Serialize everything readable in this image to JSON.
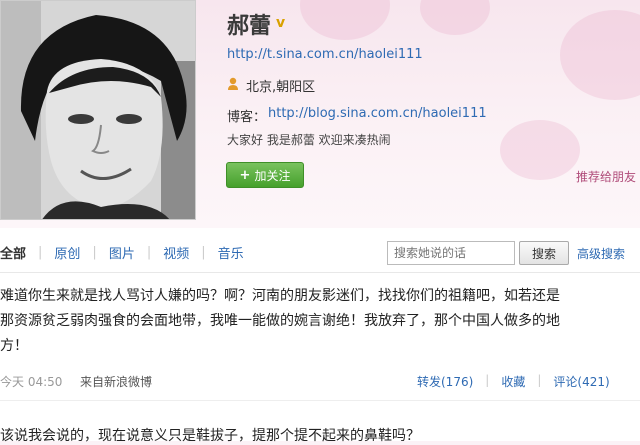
{
  "profile": {
    "name": "郝蕾",
    "verified_badge": "v",
    "weibo_url": "http://t.sina.com.cn/haolei111",
    "location": "北京,朝阳区",
    "blog_label": "博客：",
    "blog_url": "http://blog.sina.com.cn/haolei111",
    "intro": "大家好  我是郝蕾  欢迎来凑热闹",
    "follow_label": "加关注",
    "follow_plus": "+",
    "recommend_label": "推荐给朋友"
  },
  "nav": {
    "tabs": [
      {
        "label": "全部"
      },
      {
        "label": "原创"
      },
      {
        "label": "图片"
      },
      {
        "label": "视频"
      },
      {
        "label": "音乐"
      }
    ],
    "search_placeholder": "搜索她说的话",
    "search_button": "搜索",
    "advanced_search": "高级搜索"
  },
  "post": {
    "lines": [
      "难道你生来就是找人骂讨人嫌的吗？啊？河南的朋友影迷们，找找你们的祖籍吧，如若还是",
      "那资源贫乏弱肉强食的会面地带，我唯一能做的婉言谢绝！我放弃了，那个中国人做多的地",
      "方！"
    ],
    "time": "今天  04:50",
    "source": "来自新浪微博",
    "forward": "转发(176)",
    "favorite": "收藏",
    "comment": "评论(421)"
  },
  "post2": {
    "text": "该说我会说的，现在说意义只是鞋拔子，提那个提不起来的鼻鞋吗？"
  },
  "colors": {
    "link": "#2e6ab3",
    "follow_green": "#46a02c",
    "banner_pink": "#f7e6ee",
    "verified_gold": "#d9a100"
  }
}
